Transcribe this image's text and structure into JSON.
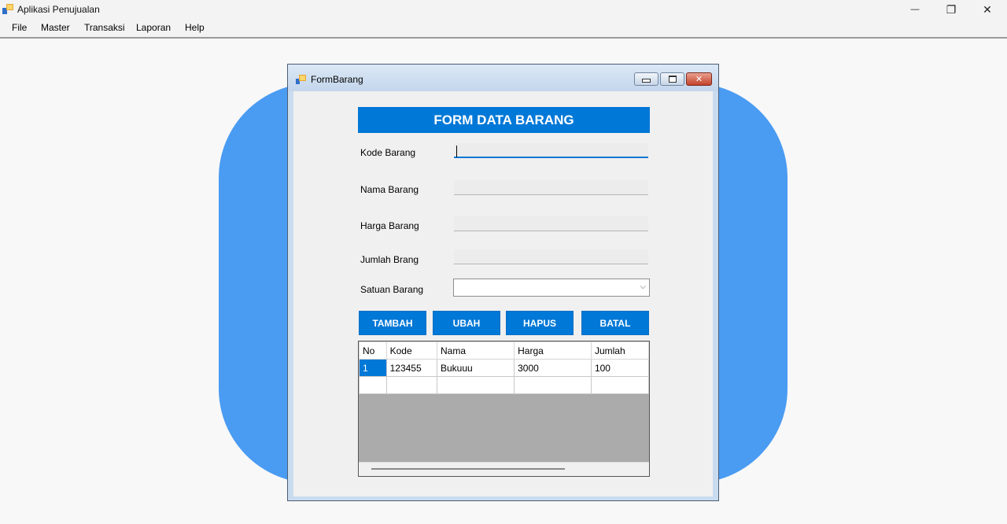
{
  "window": {
    "title": "Aplikasi Penujualan",
    "minimize_glyph": "—",
    "restore_glyph": "❐",
    "close_glyph": "✕"
  },
  "menu": [
    "File",
    "Master",
    "Transaksi",
    "Laporan",
    "Help"
  ],
  "child_window": {
    "title": "FormBarang",
    "close_glyph": "✕"
  },
  "form": {
    "header": "FORM DATA BARANG",
    "fields": {
      "kode": {
        "label": "Kode Barang",
        "value": ""
      },
      "nama": {
        "label": "Nama Barang",
        "value": ""
      },
      "harga": {
        "label": "Harga Barang",
        "value": ""
      },
      "jumlah": {
        "label": "Jumlah Brang",
        "value": ""
      },
      "satuan": {
        "label": "Satuan Barang",
        "value": "",
        "chevron": "⌵"
      }
    },
    "buttons": {
      "tambah": "TAMBAH",
      "ubah": "UBAH",
      "hapus": "HAPUS",
      "batal": "BATAL"
    }
  },
  "grid": {
    "columns": [
      "No",
      "Kode",
      "Nama",
      "Harga",
      "Jumlah"
    ],
    "rows": [
      {
        "no": "1",
        "kode": "123455",
        "nama": "Bukuuu",
        "harga": "3000",
        "jumlah": "100"
      }
    ],
    "selected_cell": "no-1"
  },
  "colors": {
    "accent": "#0078d7",
    "background_shape": "#4a9bf2",
    "grid_empty": "#ababab"
  },
  "icons": {
    "app": "app-icon",
    "form": "form-icon",
    "dropdown": "chevron-down-icon"
  }
}
